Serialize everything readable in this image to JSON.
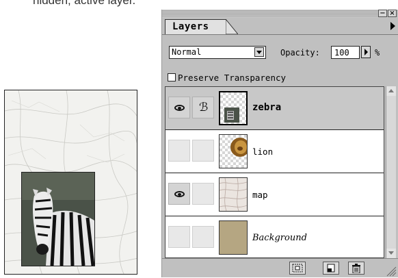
{
  "caption": "hidden; active layer.",
  "palette": {
    "tab_label": "Layers",
    "blend_mode": "Normal",
    "opacity_label": "Opacity:",
    "opacity_value": "100",
    "opacity_unit": "%",
    "preserve_transparency_label": "Preserve Transparency",
    "preserve_transparency_checked": false,
    "layers": [
      {
        "name": "zebra",
        "visible": true,
        "brush": true,
        "active": true
      },
      {
        "name": "lion",
        "visible": false,
        "brush": false,
        "active": false
      },
      {
        "name": "map",
        "visible": true,
        "brush": false,
        "active": false
      },
      {
        "name": "Background",
        "visible": false,
        "brush": false,
        "active": false
      }
    ],
    "icons": [
      "palette-menu-arrow-icon",
      "new-layer-mask-icon",
      "new-layer-icon",
      "trash-icon"
    ]
  },
  "colors": {
    "palette_bg": "#c0c0c0",
    "active_row": "#c8c8c8",
    "background_swatch": "#b5a682"
  }
}
